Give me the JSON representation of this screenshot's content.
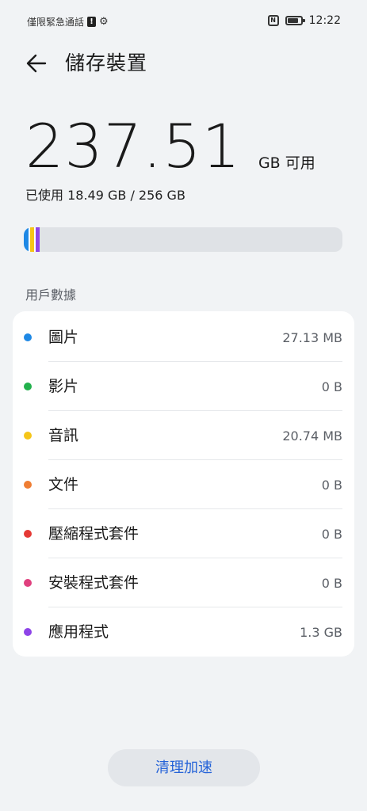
{
  "status_bar": {
    "left_text": "僅限緊急通話",
    "time": "12:22",
    "battery_level": 0.7
  },
  "header": {
    "title": "儲存裝置"
  },
  "storage": {
    "available_value": "237.51",
    "available_unit": "GB 可用",
    "used_text": "已使用 18.49 GB / 256 GB",
    "bar_segments": [
      {
        "name": "圖片",
        "color": "#1e88e5"
      },
      {
        "name": "音訊",
        "color": "#f5c518"
      },
      {
        "name": "應用程式",
        "color": "#8e44e8"
      }
    ]
  },
  "section_label": "用戶數據",
  "categories": [
    {
      "name": "圖片",
      "size": "27.13 MB",
      "color": "#1e88e5"
    },
    {
      "name": "影片",
      "size": "0 B",
      "color": "#22b14c"
    },
    {
      "name": "音訊",
      "size": "20.74 MB",
      "color": "#f5c518"
    },
    {
      "name": "文件",
      "size": "0 B",
      "color": "#ef7d33"
    },
    {
      "name": "壓縮程式套件",
      "size": "0 B",
      "color": "#e53935"
    },
    {
      "name": "安裝程式套件",
      "size": "0 B",
      "color": "#e0407e"
    },
    {
      "name": "應用程式",
      "size": "1.3 GB",
      "color": "#8e44e8"
    }
  ],
  "actions": {
    "clean_label": "清理加速"
  }
}
